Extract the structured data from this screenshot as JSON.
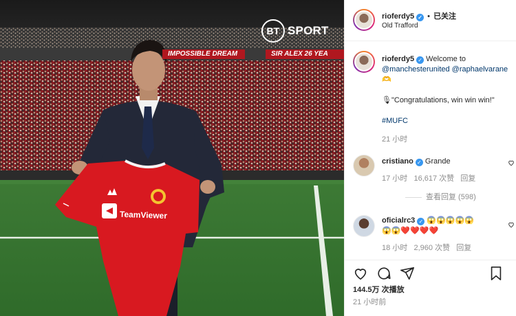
{
  "media": {
    "broadcaster_circle": "BT",
    "broadcaster_name": "SPORT",
    "banner_left": "IMPOSSIBLE DREAM",
    "banner_right": "SIR ALEX 26 YEA",
    "shirt_sponsor": "TeamViewer"
  },
  "header": {
    "username": "rioferdy5",
    "separator": "•",
    "follow_status": "已关注",
    "location": "Old Trafford"
  },
  "caption": {
    "username": "rioferdy5",
    "text_intro": "Welcome to",
    "mention_1": "@manchesterunited",
    "mention_2": "@raphaelvarane",
    "emoji_line": "🫶",
    "quote": "🎙\"Congratulations, win win win!\"",
    "hashtag": "#MUFC",
    "time": "21 小时"
  },
  "comments": [
    {
      "username": "cristiano",
      "text": "Grande",
      "time": "17 小时",
      "likes": "16,617 次赞",
      "reply": "回复",
      "view_replies": "查看回复 (598)"
    },
    {
      "username": "oficialrc3",
      "text_line1": "😱😱😱😱😱",
      "text_line2": "😱😱❤️❤️❤️❤️",
      "time": "18 小时",
      "likes": "2,960 次赞",
      "reply": "回复"
    }
  ],
  "footer": {
    "views": "144.5万 次播放",
    "time": "21 小时前"
  },
  "colors": {
    "verified": "#3897f0",
    "link": "#00376b",
    "muted": "#8e8e8e",
    "mufc_red": "#d81920"
  },
  "icons": [
    "heart-icon",
    "comment-icon",
    "share-icon",
    "bookmark-icon",
    "verified-badge-icon",
    "microphone-emoji"
  ]
}
